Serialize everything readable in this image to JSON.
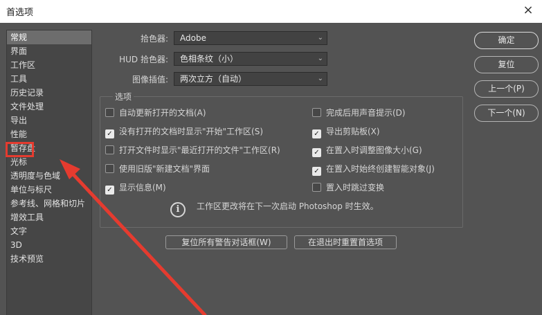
{
  "window": {
    "title": "首选项",
    "close_icon": "×"
  },
  "sidebar": {
    "items": [
      {
        "label": "常规",
        "selected": true
      },
      {
        "label": "界面"
      },
      {
        "label": "工作区"
      },
      {
        "label": "工具"
      },
      {
        "label": "历史记录"
      },
      {
        "label": "文件处理"
      },
      {
        "label": "导出"
      },
      {
        "label": "性能"
      },
      {
        "label": "暂存盘"
      },
      {
        "label": "光标"
      },
      {
        "label": "透明度与色域"
      },
      {
        "label": "单位与标尺"
      },
      {
        "label": "参考线、网格和切片"
      },
      {
        "label": "增效工具"
      },
      {
        "label": "文字"
      },
      {
        "label": "3D"
      },
      {
        "label": "技术预览"
      }
    ]
  },
  "fields": {
    "color_picker": {
      "label": "拾色器:",
      "value": "Adobe"
    },
    "hud_color_picker": {
      "label": "HUD 拾色器:",
      "value": "色相条纹（小）"
    },
    "interpolation": {
      "label": "图像插值:",
      "value": "两次立方（自动）"
    }
  },
  "options": {
    "title": "选项",
    "left": [
      {
        "label": "自动更新打开的文档(A)",
        "checked": false
      },
      {
        "label": "没有打开的文档时显示\"开始\"工作区(S)",
        "checked": true
      },
      {
        "label": "打开文件时显示\"最近打开的文件\"工作区(R)",
        "checked": false
      },
      {
        "label": "使用旧版\"新建文档\"界面",
        "checked": false
      },
      {
        "label": "显示信息(M)",
        "checked": true
      }
    ],
    "right": [
      {
        "label": "完成后用声音提示(D)",
        "checked": false
      },
      {
        "label": "导出剪贴板(X)",
        "checked": true
      },
      {
        "label": "在置入时调整图像大小(G)",
        "checked": true
      },
      {
        "label": "在置入时始终创建智能对象(J)",
        "checked": true
      },
      {
        "label": "置入时跳过变换",
        "checked": false
      }
    ],
    "info_text": "工作区更改将在下一次启动 Photoshop 时生效。"
  },
  "buttons": {
    "reset_warnings": "复位所有警告对话框(W)",
    "reset_prefs": "在退出时重置首选项",
    "ok": "确定",
    "reset": "复位",
    "prev": "上一个(P)",
    "next": "下一个(N)"
  },
  "colors": {
    "annotation": "#e53b2f",
    "panel_bg": "#535353"
  }
}
